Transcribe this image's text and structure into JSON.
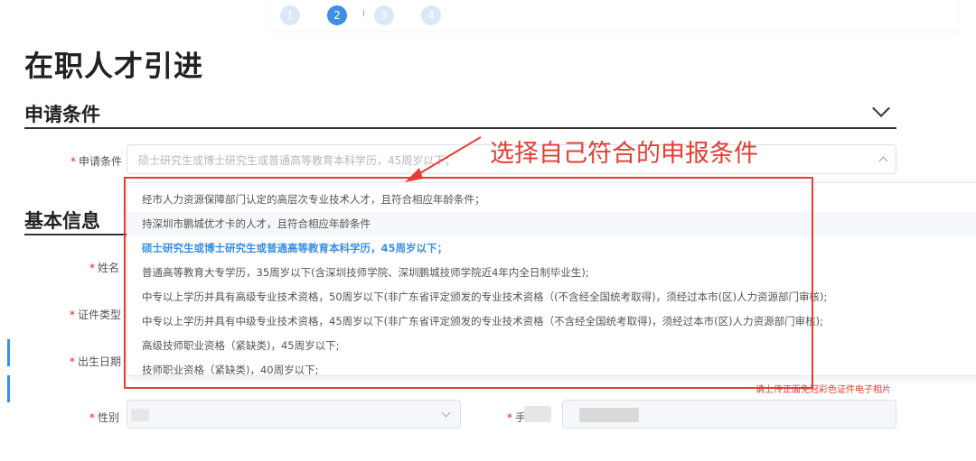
{
  "steps": [
    "1",
    "2",
    "3",
    "4"
  ],
  "step_separator": "i",
  "page_title": "在职人才引进",
  "sections": {
    "conditions": {
      "title": "申请条件"
    },
    "basic": {
      "title": "基本信息"
    }
  },
  "fields": {
    "condition": {
      "label": "申请条件",
      "value": "硕士研究生或博士研究生或普通高等教育本科学历，45周岁以下；"
    },
    "name": {
      "label": "姓名"
    },
    "id_type": {
      "label": "证件类型"
    },
    "birth": {
      "label": "出生日期"
    },
    "gender": {
      "label": "性别"
    },
    "phone": {
      "label": "手"
    }
  },
  "dropdown_options": [
    "经市人力资源保障部门认定的高层次专业技术人才，且符合相应年龄条件；",
    "持深圳市鹏城优才卡的人才，且符合相应年龄条件",
    "硕士研究生或博士研究生或普通高等教育本科学历，45周岁以下；",
    "普通高等教育大专学历，35周岁以下(含深圳技师学院、深圳鹏城技师学院近4年内全日制毕业生);",
    "中专以上学历并具有高级专业技术资格，50周岁以下(非广东省评定颁发的专业技术资格（(不含经全国统考取得)，须经过本市(区)人力资源部门审核);",
    "中专以上学历并具有中级专业技术资格，45周岁以下(非广东省评定颁发的专业技术资格（不含经全国统考取得)，须经过本市(区)人力资源部门审核);",
    "高级技师职业资格（紧缺类)，45周岁以下;",
    "技师职业资格（紧缺类)，40周岁以下;"
  ],
  "callout_text": "选择自己符合的申报条件",
  "photo_hint": "请上传正面免冠彩色证件电子相片",
  "colors": {
    "primary": "#3b8fe4",
    "annotation": "#e43d33",
    "required": "#e0211c"
  }
}
